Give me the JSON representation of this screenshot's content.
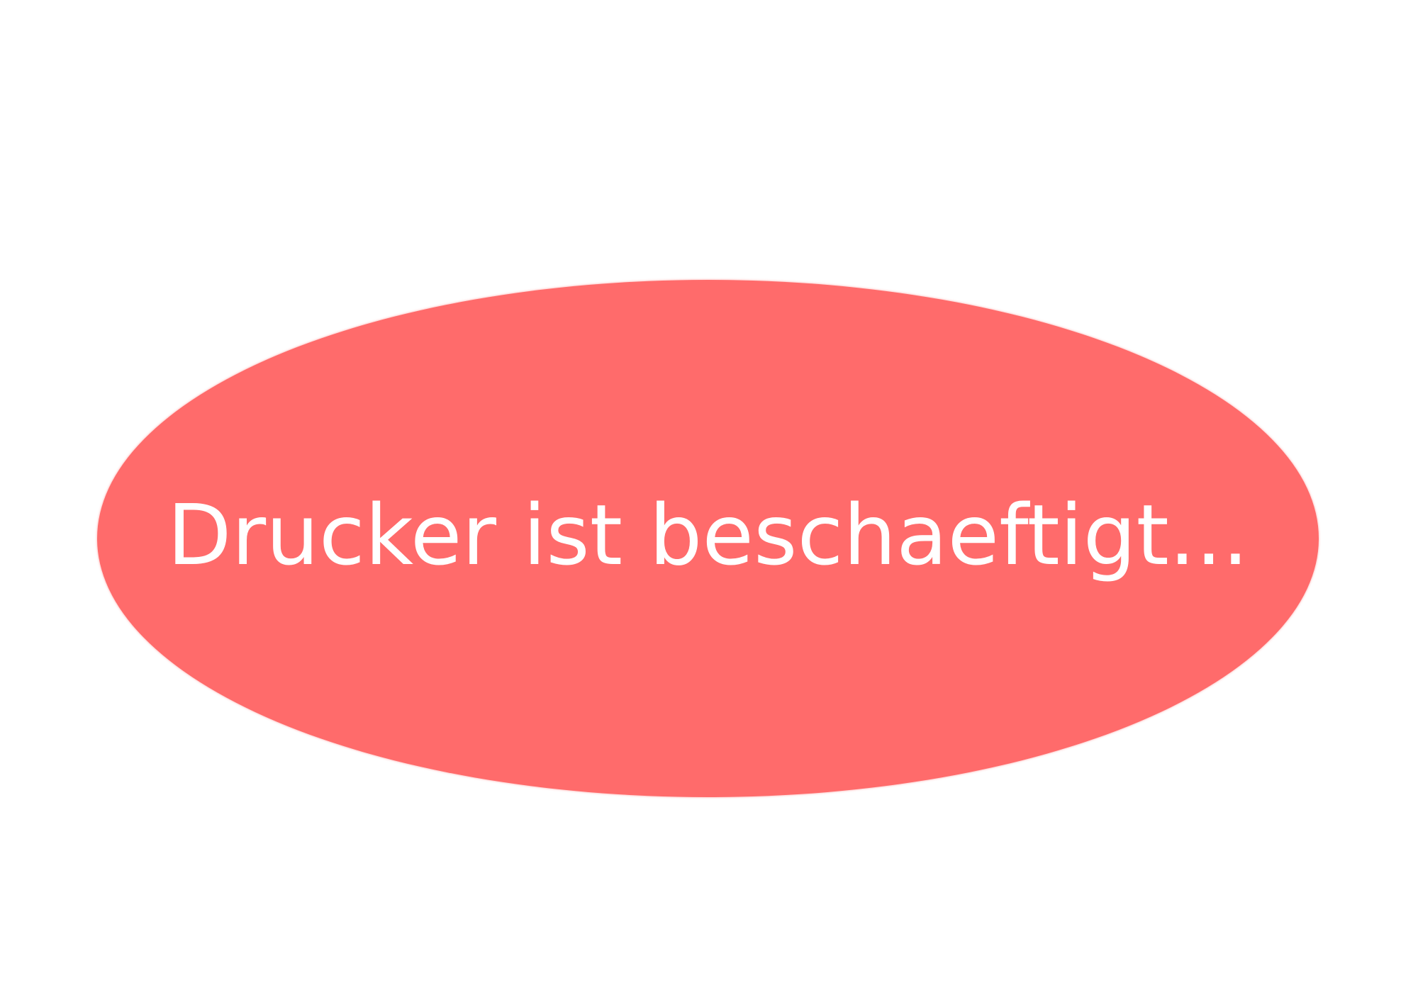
{
  "status": {
    "message": "Drucker ist beschaeftigt...",
    "background_color": "#FF6B6B",
    "text_color": "#FFFFFF"
  }
}
